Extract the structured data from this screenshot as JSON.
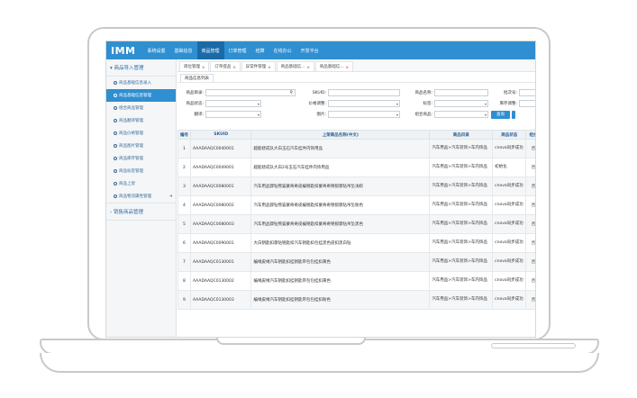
{
  "app": {
    "logo": "IMM",
    "menu": [
      "系统设置",
      "基础信息",
      "商品管理",
      "订单管理",
      "结算",
      "在线办公",
      "开发平台"
    ],
    "active_menu_index": 2
  },
  "sidebar": {
    "group1": "商品导入管理",
    "items": [
      {
        "label": "商品基础信息录入"
      },
      {
        "label": "商品基础信息管理",
        "active": true
      },
      {
        "label": "组合商品管理"
      },
      {
        "label": "商品翻译管理"
      },
      {
        "label": "商品价格管理"
      },
      {
        "label": "商品图片管理"
      },
      {
        "label": "商品库存管理"
      },
      {
        "label": "商品标签管理"
      },
      {
        "label": "商品上架"
      },
      {
        "label": "商品物流属性管理"
      }
    ],
    "group2": "销售商品管理"
  },
  "tabs": [
    {
      "label": "岗位管理"
    },
    {
      "label": "订单提品"
    },
    {
      "label": "异常件管理"
    },
    {
      "label": "商品基础信..."
    },
    {
      "label": "商品基础信...",
      "active": true
    }
  ],
  "subtab": "商品信息列表",
  "filters": {
    "category": "商品目录:",
    "skuid": "SKUID:",
    "name": "商品名称:",
    "batch": "批次号:",
    "status": "商品状态:",
    "price_adj": "价格调整:",
    "label": "标签:",
    "stock_adj": "库存调整:",
    "translate": "翻译:",
    "image": "图片:",
    "combo": "组合商品:",
    "search_btn": "查询"
  },
  "table": {
    "headers": [
      "编号",
      "SKUID",
      "上架商品名称(中文)",
      "商品目录",
      "商品状态",
      "组合",
      "翻译"
    ],
    "rows": [
      {
        "no": "1",
        "sku": "AAADAAQC0040001",
        "name": "越能绕成队大白玉石汽车挂件内饰用品",
        "cat": "汽车用品>汽车装饰>车内饰品",
        "status": "cnova同步成功",
        "combo": "否",
        "tr": "是"
      },
      {
        "no": "2",
        "sku": "AAADAAQC0049001",
        "name": "越能绕成队大白2号玉石汽车挂件内饰用品",
        "cat": "汽车用品>汽车装饰>车内饰品",
        "status": "初始化",
        "combo": "否",
        "tr": "是"
      },
      {
        "no": "3",
        "sku": "AAADAAQC0080001",
        "name": "汽车用品骤钻熊猫蒙奇奇皮编钥匙扣蒙奇奇钥锁骤钻吊坠浅棕",
        "cat": "汽车用品>汽车装饰>车内饰品",
        "status": "cnova同步成功",
        "combo": "否",
        "tr": "是"
      },
      {
        "no": "4",
        "sku": "AAADAAQC0080002",
        "name": "汽车用品骤钻熊猫蒙奇奇皮编钥匙扣蒙奇奇钥锁骤钻吊坠粉色",
        "cat": "汽车用品>汽车装饰>车内饰品",
        "status": "cnova同步成功",
        "combo": "否",
        "tr": "是"
      },
      {
        "no": "5",
        "sku": "AAADAAQC0080003",
        "name": "汽车用品骤钻熊猫蒙奇奇皮编钥匙扣蒙奇奇钥锁骤钻吊坠黑色",
        "cat": "汽车用品>汽车装饰>车内饰品",
        "status": "cnova同步成功",
        "combo": "否",
        "tr": "是"
      },
      {
        "no": "6",
        "sku": "AAADAAQC0090001",
        "name": "大白钥匙扣骤钻钥匙扣汽车钥匙扣包挂黑色皮扣黑白钻",
        "cat": "汽车用品>汽车装饰>车内饰品",
        "status": "cnova同步成功",
        "combo": "否",
        "tr": "是"
      },
      {
        "no": "7",
        "sku": "AAADAAQC0130001",
        "name": "编绳皮绳汽车钥匙扣挂钥匙带包包挂扣黄色",
        "cat": "汽车用品>汽车装饰>车内饰品",
        "status": "cnova同步成功",
        "combo": "否",
        "tr": "是"
      },
      {
        "no": "8",
        "sku": "AAADAAQC0130002",
        "name": "编绳皮绳汽车钥匙扣挂钥匙带包包挂扣黄色",
        "cat": "汽车用品>汽车装饰>车内饰品",
        "status": "cnova同步成功",
        "combo": "否",
        "tr": "是"
      },
      {
        "no": "9",
        "sku": "AAADAAQC0130003",
        "name": "编绳皮绳汽车钥匙扣挂钥匙带包包挂扣粉色",
        "cat": "汽车用品>汽车装饰>车内饰品",
        "status": "cnova同步成功",
        "combo": "否",
        "tr": "是"
      }
    ]
  },
  "colors": {
    "brand": "#2f8fd0",
    "active_menu": "#1b6aa8",
    "sidebar_bg": "#f4f6f8"
  }
}
